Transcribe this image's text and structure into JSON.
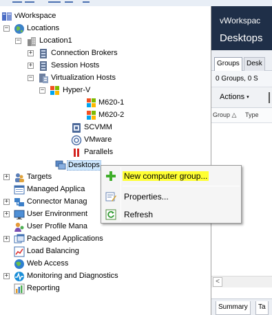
{
  "tree": {
    "root": "vWorkspace",
    "locations": "Locations",
    "location1": "Location1",
    "connection_brokers": "Connection Brokers",
    "session_hosts": "Session Hosts",
    "virtualization_hosts": "Virtualization Hosts",
    "hyperv": "Hyper-V",
    "m620_1": "M620-1",
    "m620_2": "M620-2",
    "scvmm": "SCVMM",
    "vmware": "VMware",
    "parallels": "Parallels",
    "desktops": "Desktops",
    "targets": "Targets",
    "managed_apps": "Managed Applica",
    "connector_mgmt": "Connector Manag",
    "user_env": "User Environment",
    "user_profile": "User Profile Mana",
    "packaged_apps": "Packaged Applications",
    "load_balancing": "Load Balancing",
    "web_access": "Web Access",
    "monitoring": "Monitoring and Diagnostics",
    "reporting": "Reporting"
  },
  "context_menu": {
    "new_group": "New computer group...",
    "properties": "Properties...",
    "refresh": "Refresh"
  },
  "right_pane": {
    "title_line1": "vWorkspac",
    "title_line2": "Desktops",
    "tab_groups": "Groups",
    "tab_desk": "Desk",
    "count": "0 Groups, 0 S",
    "actions": "Actions",
    "col_group": "Group △",
    "col_type": "Type",
    "scroll_left": "<",
    "bottom_tab_summary": "Summary",
    "bottom_tab_t": "Ta"
  },
  "colors": {
    "header_bg": "#1f2f48",
    "highlight": "#ffff33",
    "selection": "#cde8ff"
  }
}
